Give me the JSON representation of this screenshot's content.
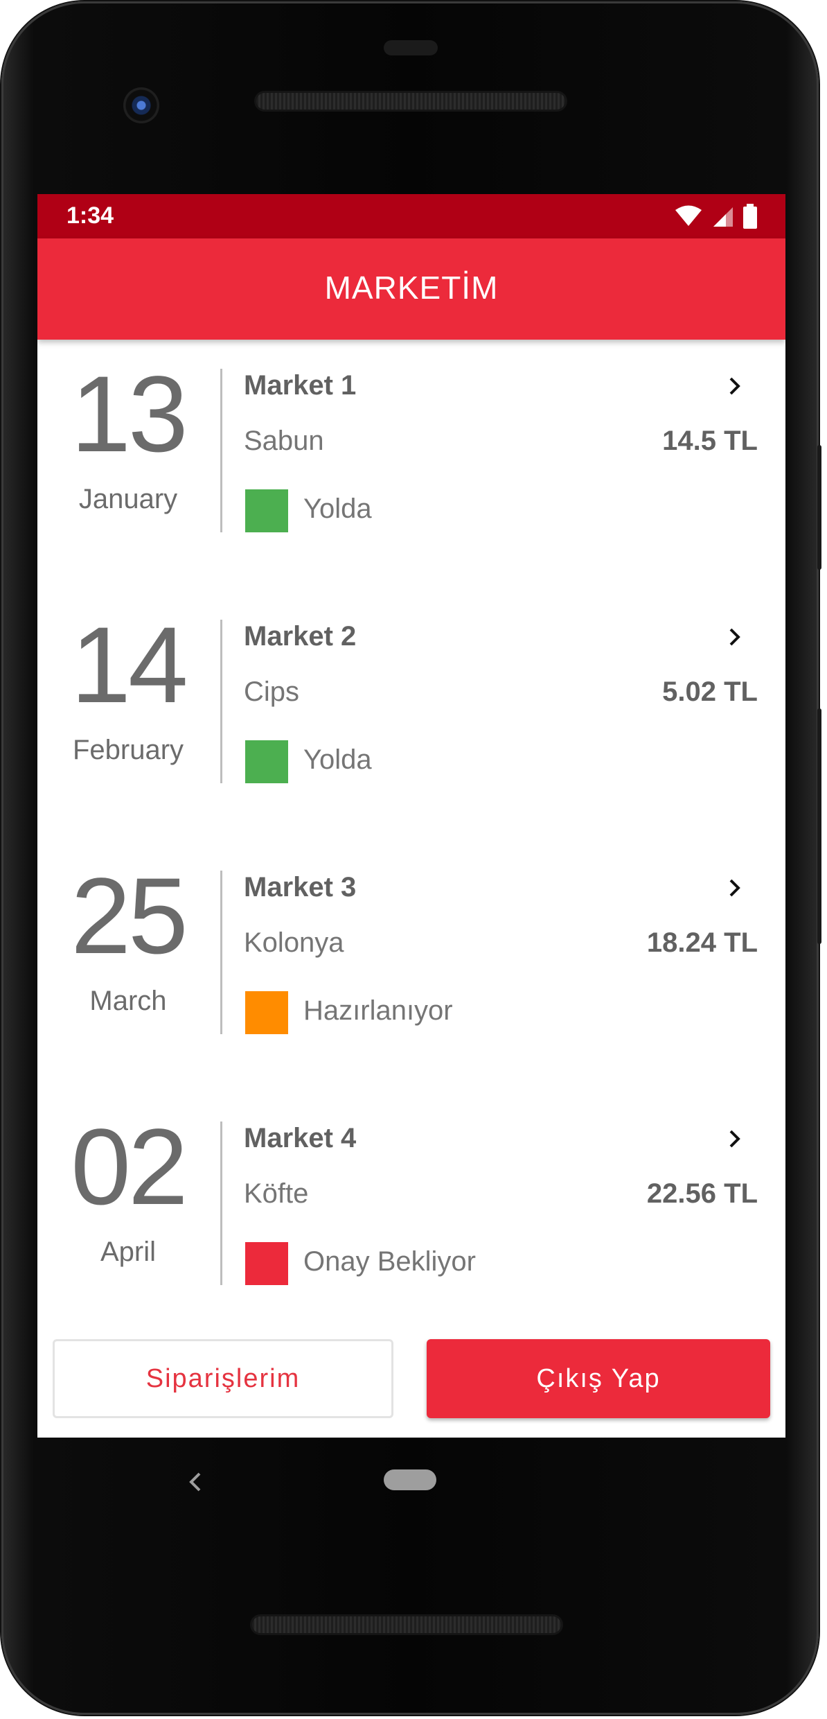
{
  "status_bar": {
    "time": "1:34"
  },
  "app_bar": {
    "title": "MARKETİM"
  },
  "orders": [
    {
      "day": "13",
      "month": "January",
      "market": "Market 1",
      "product": "Sabun",
      "price": "14.5 TL",
      "status": "Yolda",
      "status_color": "#4caf50"
    },
    {
      "day": "14",
      "month": "February",
      "market": "Market 2",
      "product": "Cips",
      "price": "5.02 TL",
      "status": "Yolda",
      "status_color": "#4caf50"
    },
    {
      "day": "25",
      "month": "March",
      "market": "Market 3",
      "product": "Kolonya",
      "price": "18.24 TL",
      "status": "Hazırlanıyor",
      "status_color": "#ff8c00"
    },
    {
      "day": "02",
      "month": "April",
      "market": "Market 4",
      "product": "Köfte",
      "price": "22.56 TL",
      "status": "Onay Bekliyor",
      "status_color": "#ec2a3b"
    }
  ],
  "buttons": {
    "orders_label": "Siparişlerim",
    "logout_label": "Çıkış Yap"
  },
  "colors": {
    "accent": "#ec2a3b",
    "status_bar": "#b00015"
  },
  "icons": {
    "row_action": "chevron-right-icon",
    "nav_back": "back-icon",
    "nav_home": "home-pill-icon"
  }
}
